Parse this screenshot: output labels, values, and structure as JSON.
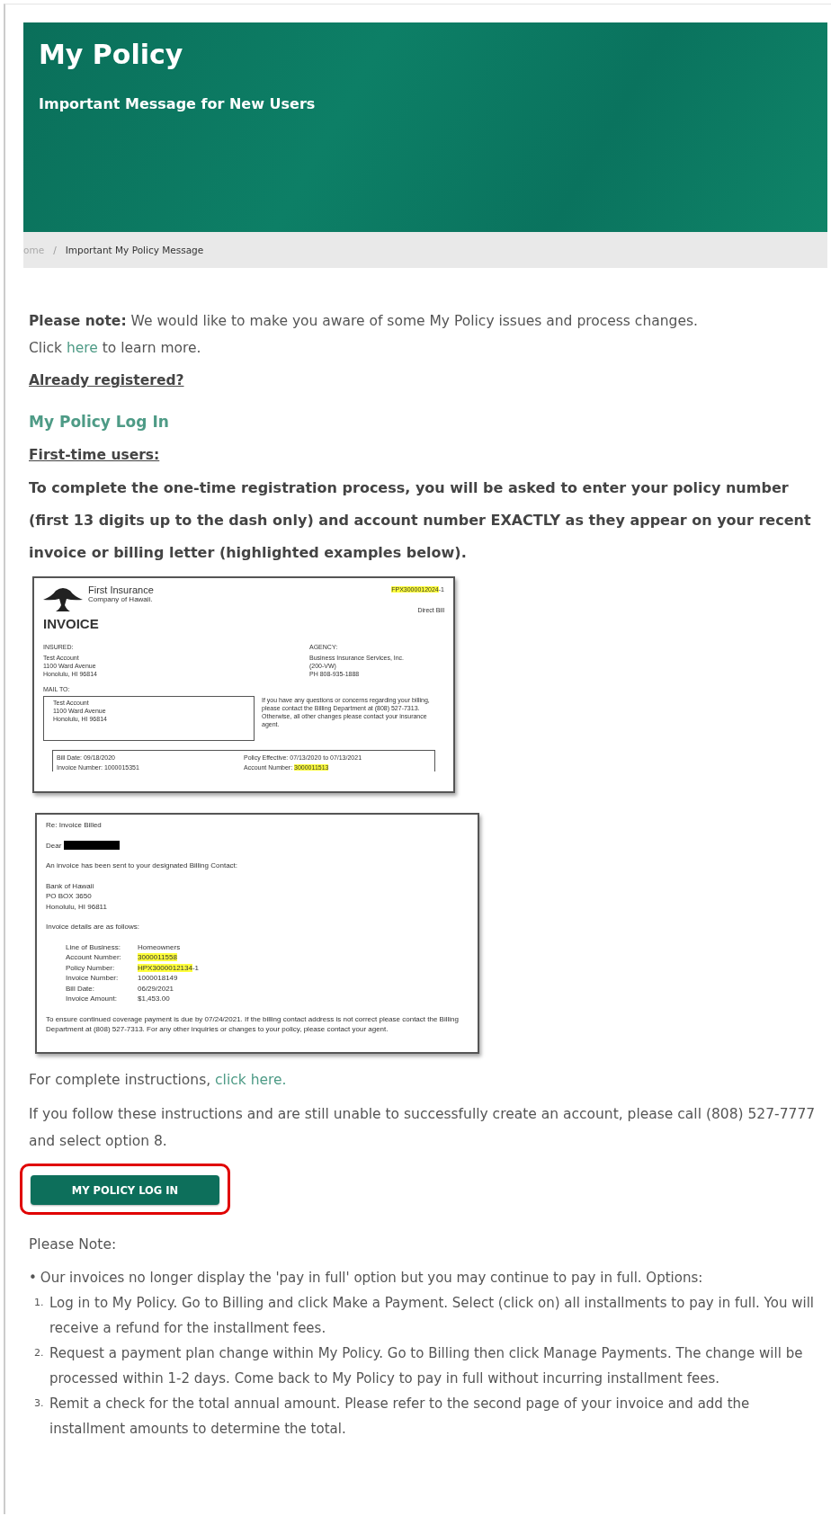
{
  "hero": {
    "title": "My Policy",
    "subtitle": "Important Message for New Users"
  },
  "breadcrumb": {
    "separator": "/",
    "items": [
      {
        "label": "ome",
        "current": false
      },
      {
        "label": "Important My Policy Message",
        "current": true
      }
    ]
  },
  "notice": {
    "text": "**Please note:** We would like to make you aware of some My Policy issues and process changes.",
    "link_prefix": "Click ",
    "link": "here",
    "link_suffix": " to learn more."
  },
  "registered_heading": "Already registered?",
  "login_link": "My Policy Log In",
  "first_time_heading": "First-time users:",
  "instructions": "To complete the one-time registration process, you will be asked to enter your policy number (first 13 digits up to the dash only) and account number EXACTLY as they appear on your recent invoice or billing letter (highlighted examples below).",
  "invoice": {
    "company": "First Insurance",
    "company_sub": "Company of Hawaii.",
    "title": "INVOICE",
    "policy_number": {
      "value": "FPX3000012024",
      "suffix": "-1",
      "highlighted": true
    },
    "bill_type": "Direct Bill",
    "insured": {
      "label": "INSURED:",
      "lines": [
        "Test Account",
        "1100 Ward Avenue",
        "Honolulu, HI 96814"
      ]
    },
    "agency": {
      "label": "AGENCY:",
      "lines": [
        "Business Insurance Services, Inc.",
        "(200-VW)",
        "PH 808-935-1888"
      ]
    },
    "mail_to": {
      "label": "MAIL TO:",
      "lines": [
        "Test Account",
        "1100 Ward Avenue",
        "Honolulu, HI 96814"
      ]
    },
    "contact_note": "If you have any questions or concerns regarding your billing, please contact the Billing Department at (808) 527-7313. Otherwise, all other changes please contact your insurance agent.",
    "summary": [
      {
        "label": "Bill Date:",
        "value": "09/18/2020",
        "highlighted": false
      },
      {
        "label": "Policy Effective:",
        "value": "07/13/2020 to 07/13/2021",
        "highlighted": false
      },
      {
        "label": "Invoice Number:",
        "value": "1000015351",
        "highlighted": false
      },
      {
        "label": "Account Number:",
        "value": "3000011513",
        "highlighted": true
      }
    ]
  },
  "letter": {
    "subject": "Re: Invoice Billed",
    "greeting": "Dear",
    "redacted": true,
    "intro": "An invoice has been sent to your designated Billing Contact:",
    "address": [
      "Bank of Hawaii",
      "PO BOX 3650",
      "Honolulu, HI 96811"
    ],
    "details_intro": "Invoice details are as follows:",
    "details": [
      {
        "label": "Line of Business:",
        "value": "Homeowners",
        "highlighted": false
      },
      {
        "label": "Account Number:",
        "value": "3000011558",
        "highlighted": true
      },
      {
        "label": "Policy Number:",
        "value": "HPX3000012134",
        "suffix": "-1",
        "highlighted": true
      },
      {
        "label": "Invoice Number:",
        "value": "1000018149",
        "highlighted": false
      },
      {
        "label": "Bill Date:",
        "value": "06/29/2021",
        "highlighted": false
      },
      {
        "label": "Invoice Amount:",
        "value": "$1,453.00",
        "highlighted": false
      }
    ],
    "footer": "To ensure continued coverage payment is due by 07/24/2021. If the billing contact address is not correct please contact the Billing Department at (808) 527-7313. For any other inquiries or changes to your policy, please contact your agent."
  },
  "complete_instructions": {
    "prefix": "For complete instructions, ",
    "link": "click here."
  },
  "help_text": "If you follow these instructions and are still unable to successfully create an account, please call (808) 527-7777 and select option 8.",
  "login_button": {
    "label": "MY POLICY LOG IN",
    "highlighted": true
  },
  "note_heading": "Please Note:",
  "bullet": {
    "marker": "•",
    "text": "Our invoices no longer display the 'pay in full' option but you may continue to pay in full. Options:",
    "options": [
      {
        "number": "1.",
        "text": "Log in to My Policy. Go to Billing and click Make a Payment. Select (click on) all installments to pay in full. You will receive a refund for the installment fees."
      },
      {
        "number": "2.",
        "text": "Request a payment plan change within My Policy. Go to Billing then click Manage Payments. The change will be processed within 1-2 days. Come back to My Policy to pay in full without incurring installment fees."
      },
      {
        "number": "3.",
        "text": "Remit a check for the total annual amount. Please refer to the second page of your invoice and add the installment amounts to determine the total."
      }
    ]
  }
}
